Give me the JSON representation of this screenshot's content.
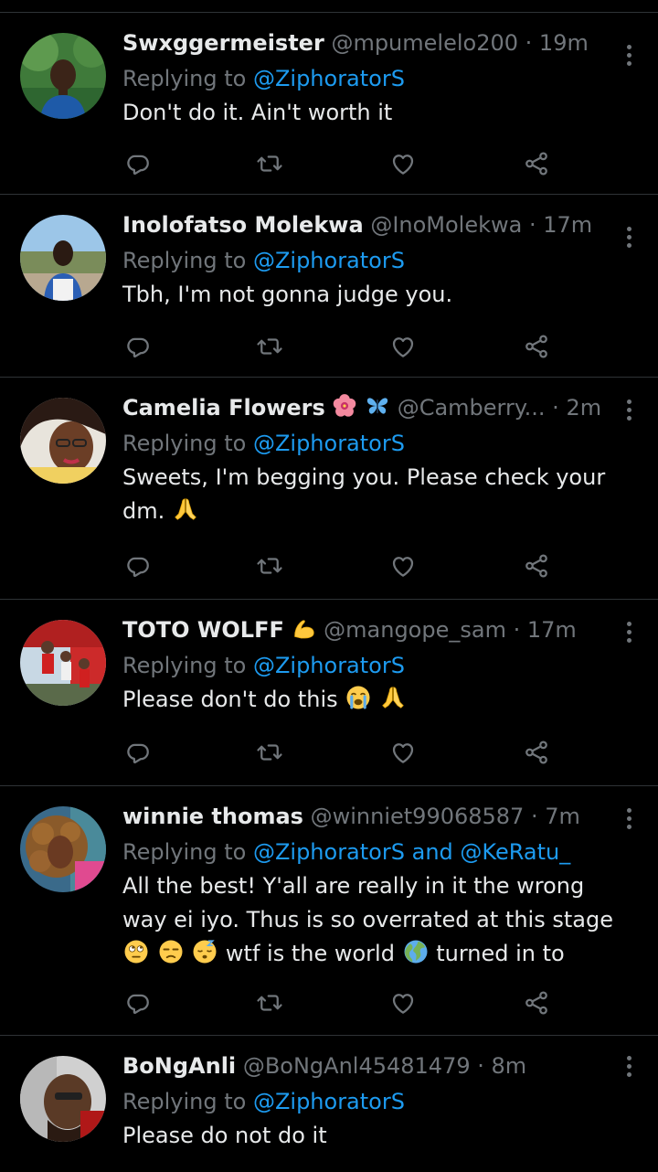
{
  "colors": {
    "background": "#000000",
    "divider": "#2f3336",
    "primary_text": "#e7e9ea",
    "secondary_text": "#71767b",
    "mention": "#1d9bf0"
  },
  "labels": {
    "replying_to": "Replying to",
    "dot": "·",
    "and": "and"
  },
  "icons": {
    "reply": "reply-icon",
    "retweet": "retweet-icon",
    "like": "heart-icon",
    "share": "share-icon",
    "more": "more-options-icon"
  },
  "tweets": [
    {
      "name": "Swxggermeister",
      "handle": "@mpumelelo200",
      "time": "19m",
      "replying_to": [
        "@ZiphoratorS"
      ],
      "text": "Don't do it. Ain't worth it"
    },
    {
      "name": "Inolofatso Molekwa",
      "handle": "@InoMolekwa",
      "time": "17m",
      "replying_to": [
        "@ZiphoratorS"
      ],
      "text": "Tbh, I'm not gonna judge you."
    },
    {
      "name": "Camelia Flowers",
      "name_emojis": [
        "hibiscus-emoji",
        "butterfly-emoji"
      ],
      "handle": "@Camberry...",
      "time": "2m",
      "replying_to": [
        "@ZiphoratorS"
      ],
      "text": "Sweets, I'm begging you. Please check your",
      "text_line2": "dm.",
      "text_emojis": [
        "folded-hands-emoji"
      ]
    },
    {
      "name": "TOTO WOLFF",
      "name_emojis": [
        "flexed-biceps-emoji"
      ],
      "handle": "@mangope_sam",
      "time": "17m",
      "replying_to": [
        "@ZiphoratorS"
      ],
      "text": "Please don't do this",
      "text_emojis": [
        "loudly-crying-face-emoji",
        "folded-hands-emoji"
      ]
    },
    {
      "name": "winnie thomas",
      "handle": "@winniet99068587",
      "time": "7m",
      "replying_to": [
        "@ZiphoratorS",
        "@KeRatu_"
      ],
      "text": "All the best! Y'all are really in it the wrong",
      "text_line2": "way ei iyo. Thus is so overrated at this stage",
      "text_line3_a": "wtf is the world",
      "text_line3_b": "turned in to",
      "text_emojis": [
        "face-with-rolling-eyes-emoji",
        "unamused-face-emoji",
        "sleeping-face-emoji",
        "globe-emoji"
      ]
    },
    {
      "name": "BoNgAnli",
      "handle": "@BoNgAnl45481479",
      "time": "8m",
      "replying_to": [
        "@ZiphoratorS"
      ],
      "text": "Please do not do it"
    }
  ]
}
